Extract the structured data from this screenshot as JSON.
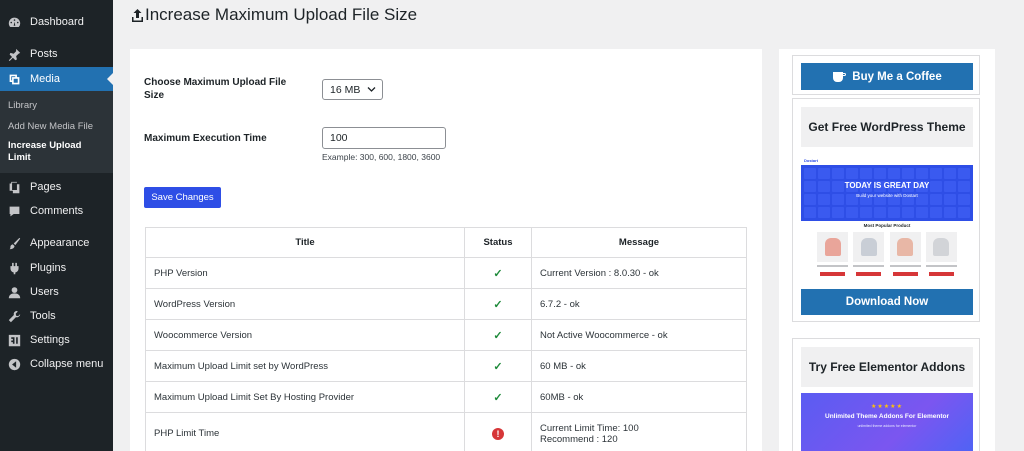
{
  "sidebar": {
    "items": [
      {
        "label": "Dashboard",
        "icon": "dashboard-icon"
      },
      {
        "label": "Posts",
        "icon": "pin-icon"
      },
      {
        "label": "Media",
        "icon": "media-icon"
      },
      {
        "label": "Pages",
        "icon": "pages-icon"
      },
      {
        "label": "Comments",
        "icon": "comment-icon"
      },
      {
        "label": "Appearance",
        "icon": "brush-icon"
      },
      {
        "label": "Plugins",
        "icon": "plugin-icon"
      },
      {
        "label": "Users",
        "icon": "user-icon"
      },
      {
        "label": "Tools",
        "icon": "wrench-icon"
      },
      {
        "label": "Settings",
        "icon": "settings-icon"
      },
      {
        "label": "Collapse menu",
        "icon": "collapse-icon"
      }
    ],
    "active": "Media",
    "submenu": [
      {
        "label": "Library"
      },
      {
        "label": "Add New Media File"
      },
      {
        "label": "Increase Upload Limit",
        "current": true
      }
    ]
  },
  "page": {
    "title": "Increase Maximum Upload File Size",
    "title_icon": "upload-icon"
  },
  "form": {
    "upload_label": "Choose Maximum Upload File Size",
    "upload_value": "16 MB",
    "exec_label": "Maximum Execution Time",
    "exec_value": "100",
    "exec_hint": "Example: 300, 600, 1800, 3600",
    "save_label": "Save Changes"
  },
  "table": {
    "headers": [
      "Title",
      "Status",
      "Message"
    ],
    "rows": [
      {
        "title": "PHP Version",
        "status": "ok",
        "message": "Current Version : 8.0.30 - ok"
      },
      {
        "title": "WordPress Version",
        "status": "ok",
        "message": "6.7.2 - ok"
      },
      {
        "title": "Woocommerce Version",
        "status": "ok",
        "message": "Not Active Woocommerce - ok"
      },
      {
        "title": "Maximum Upload Limit set by WordPress",
        "status": "ok",
        "message": "60 MB - ok"
      },
      {
        "title": "Maximum Upload Limit Set By Hosting Provider",
        "status": "ok",
        "message": "60MB - ok"
      },
      {
        "title": "PHP Limit Time",
        "status": "error",
        "message": "Current Limit Time: 100",
        "message2": "Recommend : 120"
      }
    ],
    "ok_glyph": "✓",
    "error_glyph": "!"
  },
  "promos": {
    "coffee_label": "Buy Me a Coffee",
    "theme_heading": "Get Free WordPress Theme",
    "theme_preview": {
      "brand": "Dostart",
      "banner_title": "TODAY IS GREAT DAY",
      "banner_sub": "Build your website with Dostart",
      "section_title": "Most Popular Product"
    },
    "download_label": "Download Now",
    "addons_heading": "Try Free Elementor Addons",
    "addons_preview": {
      "stars": "★★★★★",
      "title": "Unlimited Theme Addons For Elementor",
      "sub": "unlimited theme addons for elementor"
    }
  },
  "colors": {
    "sidebar_bg": "#1d2327",
    "active_menu": "#2271b1",
    "save_button": "#2e4ee6",
    "ok": "#1e8a3a",
    "error": "#d63638"
  }
}
